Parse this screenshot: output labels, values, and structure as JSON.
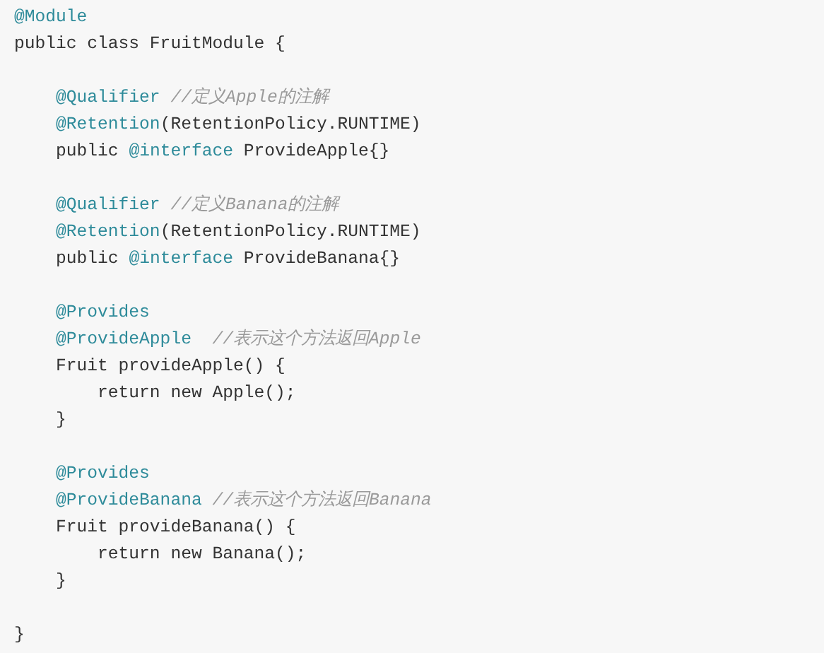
{
  "code_lines": [
    {
      "kind": "code",
      "tokens": [
        {
          "kind": "annotation",
          "text": "@Module"
        }
      ]
    },
    {
      "kind": "code",
      "tokens": [
        {
          "kind": "plain",
          "text": "public class FruitModule {"
        }
      ]
    },
    {
      "kind": "blank"
    },
    {
      "kind": "code",
      "tokens": [
        {
          "kind": "annotation",
          "text": "    @Qualifier"
        },
        {
          "kind": "comment",
          "text": " //定义Apple的注解"
        }
      ]
    },
    {
      "kind": "code",
      "tokens": [
        {
          "kind": "annotation",
          "text": "    @Retention"
        },
        {
          "kind": "plain",
          "text": "(RetentionPolicy.RUNTIME)"
        }
      ]
    },
    {
      "kind": "code",
      "tokens": [
        {
          "kind": "plain",
          "text": "    public "
        },
        {
          "kind": "annotation",
          "text": "@interface"
        },
        {
          "kind": "plain",
          "text": " ProvideApple{}"
        }
      ]
    },
    {
      "kind": "blank"
    },
    {
      "kind": "code",
      "tokens": [
        {
          "kind": "annotation",
          "text": "    @Qualifier"
        },
        {
          "kind": "comment",
          "text": " //定义Banana的注解"
        }
      ]
    },
    {
      "kind": "code",
      "tokens": [
        {
          "kind": "annotation",
          "text": "    @Retention"
        },
        {
          "kind": "plain",
          "text": "(RetentionPolicy.RUNTIME)"
        }
      ]
    },
    {
      "kind": "code",
      "tokens": [
        {
          "kind": "plain",
          "text": "    public "
        },
        {
          "kind": "annotation",
          "text": "@interface"
        },
        {
          "kind": "plain",
          "text": " ProvideBanana{}"
        }
      ]
    },
    {
      "kind": "blank"
    },
    {
      "kind": "code",
      "tokens": [
        {
          "kind": "annotation",
          "text": "    @Provides"
        }
      ]
    },
    {
      "kind": "code",
      "tokens": [
        {
          "kind": "annotation",
          "text": "    @ProvideApple"
        },
        {
          "kind": "comment",
          "text": "  //表示这个方法返回Apple"
        }
      ]
    },
    {
      "kind": "code",
      "tokens": [
        {
          "kind": "plain",
          "text": "    Fruit provideApple() {"
        }
      ]
    },
    {
      "kind": "code",
      "tokens": [
        {
          "kind": "plain",
          "text": "        return new Apple();"
        }
      ]
    },
    {
      "kind": "code",
      "tokens": [
        {
          "kind": "plain",
          "text": "    }"
        }
      ]
    },
    {
      "kind": "blank"
    },
    {
      "kind": "code",
      "tokens": [
        {
          "kind": "annotation",
          "text": "    @Provides"
        }
      ]
    },
    {
      "kind": "code",
      "tokens": [
        {
          "kind": "annotation",
          "text": "    @ProvideBanana"
        },
        {
          "kind": "comment",
          "text": " //表示这个方法返回Banana"
        }
      ]
    },
    {
      "kind": "code",
      "tokens": [
        {
          "kind": "plain",
          "text": "    Fruit provideBanana() {"
        }
      ]
    },
    {
      "kind": "code",
      "tokens": [
        {
          "kind": "plain",
          "text": "        return new Banana();"
        }
      ]
    },
    {
      "kind": "code",
      "tokens": [
        {
          "kind": "plain",
          "text": "    }"
        }
      ]
    },
    {
      "kind": "blank"
    },
    {
      "kind": "code",
      "tokens": [
        {
          "kind": "plain",
          "text": "}"
        }
      ]
    }
  ]
}
